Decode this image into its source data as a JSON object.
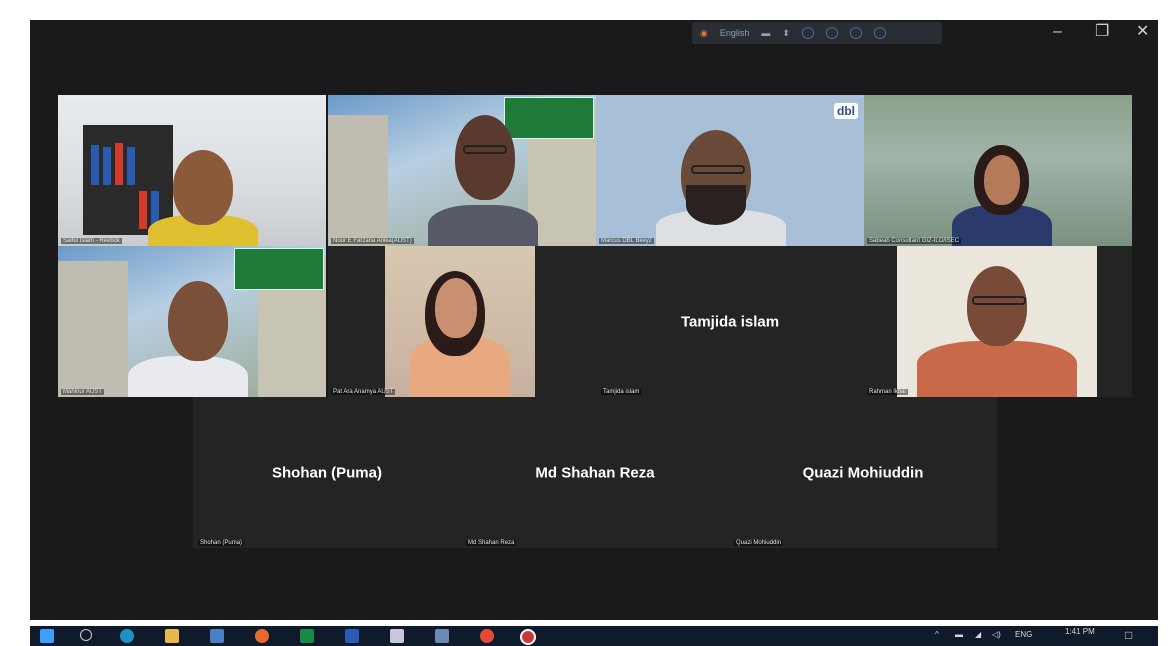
{
  "toolbar": {
    "language": "English",
    "minimize": "–",
    "restore": "❐",
    "close": "✕"
  },
  "participants": [
    {
      "label": "Saiful Islam - Reebok"
    },
    {
      "label": "Noor E Farzana Anika(AUST)"
    },
    {
      "label": "Marcus DBL Bkeyz"
    },
    {
      "label": "Sabeah Consultant GIZ-ILO/ISEC"
    },
    {
      "label": "Mahinur AUST"
    },
    {
      "label": "Pat Ara Anamya AUST"
    },
    {
      "label": "Tamjida islam",
      "display": "Tamjida islam"
    },
    {
      "label": "Rahman lkbal"
    },
    {
      "label": "Shohan (Puma)",
      "display": "Shohan (Puma)"
    },
    {
      "label": "Md Shahan Reza",
      "display": "Md Shahan Reza"
    },
    {
      "label": "Quazi Mohiuddin",
      "display": "Quazi Mohiuddin"
    }
  ],
  "brand_logo": "dbl",
  "colors": {
    "background": "#1a1a1a",
    "tile": "#242424",
    "taskbar": "#0f1a2a"
  },
  "taskbar": {
    "lang": "ENG",
    "time": "1:41 PM",
    "icons": [
      "windows-icon",
      "search-icon",
      "edge-icon",
      "file-explorer-icon",
      "store-icon",
      "firefox-icon",
      "excel-icon",
      "word-icon",
      "paint-icon",
      "photos-icon",
      "chrome-icon",
      "zoom-icon"
    ]
  }
}
